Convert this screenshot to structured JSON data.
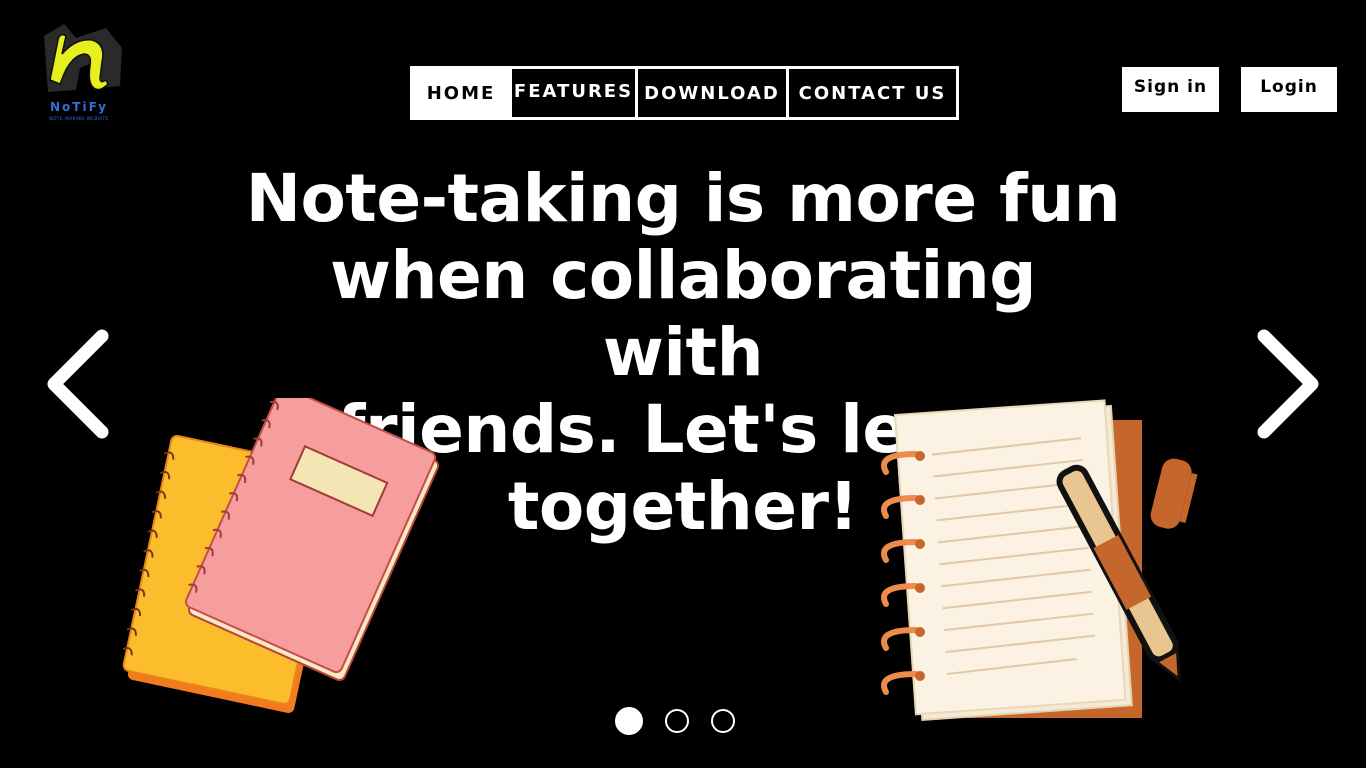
{
  "logo": {
    "name": "NoTiFy",
    "tagline": "NOTE-MAKING WEBSITE",
    "accent_color": "#e6f01e",
    "text_color": "#2f6fd6"
  },
  "nav": {
    "items": [
      {
        "label": "HOME",
        "active": true
      },
      {
        "label": "FEATURES",
        "active": false
      },
      {
        "label": "DOWNLOAD",
        "active": false
      },
      {
        "label": "CONTACT US",
        "active": false
      }
    ]
  },
  "auth": {
    "signin_label": "Sign in",
    "login_label": "Login"
  },
  "hero": {
    "line1": "Note-taking is more fun",
    "line2": "when collaborating with",
    "line3": "friends. Let's learn",
    "line4": "together!"
  },
  "carousel": {
    "prev_icon": "chevron-left-icon",
    "next_icon": "chevron-right-icon",
    "slide_count": 3,
    "active_slide": 1
  },
  "colors": {
    "background": "#000000",
    "foreground": "#ffffff"
  }
}
